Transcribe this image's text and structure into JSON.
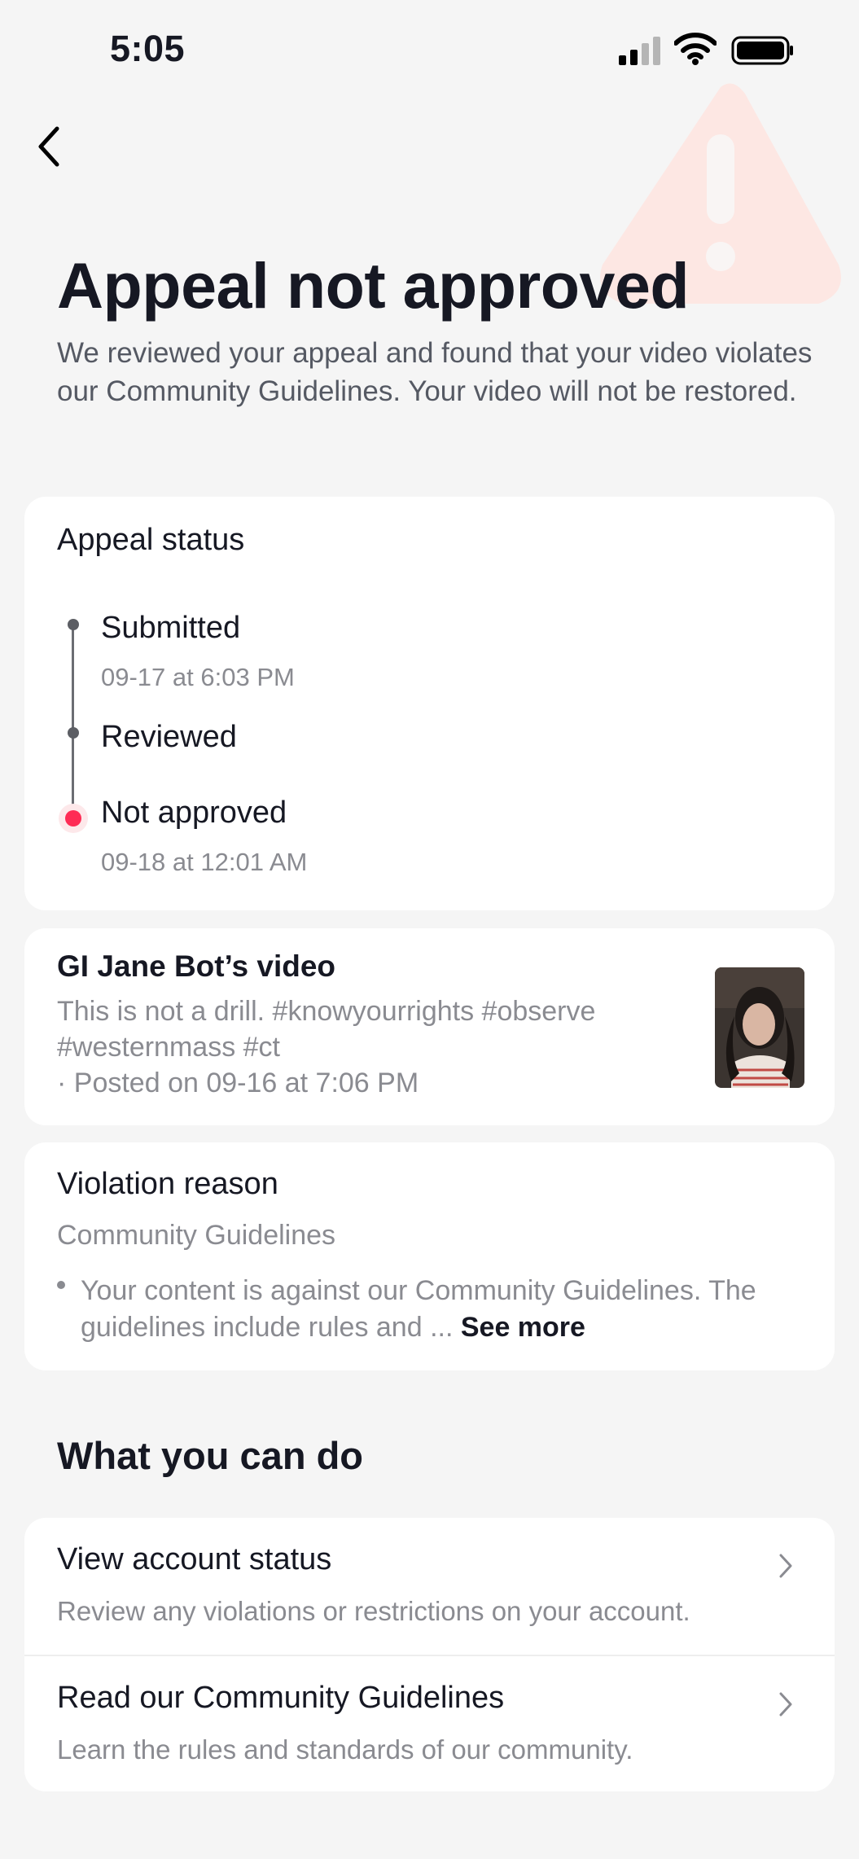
{
  "status_bar": {
    "time": "5:05"
  },
  "header": {
    "title": "Appeal not approved",
    "subtitle": "We reviewed your appeal and found that your video violates our Community Guidelines. Your video will not be restored."
  },
  "appeal_status": {
    "title": "Appeal status",
    "steps": [
      {
        "label": "Submitted",
        "time": "09-17 at 6:03 PM"
      },
      {
        "label": "Reviewed",
        "time": ""
      },
      {
        "label": "Not approved",
        "time": "09-18 at 12:01 AM"
      }
    ]
  },
  "video": {
    "title": "GI Jane Bot’s video",
    "description": "This is not a drill. #knowyourrights #observe #westernmass #ct",
    "posted": "· Posted on 09-16 at 7:06 PM"
  },
  "violation": {
    "title": "Violation reason",
    "category": "Community Guidelines",
    "detail": "Your content is against our Community Guidelines. The guidelines include rules and ... ",
    "see_more": "See more"
  },
  "what_you_can_do": {
    "title": "What you can do",
    "actions": [
      {
        "title": "View account status",
        "description": "Review any violations or restrictions on your account."
      },
      {
        "title": "Read our Community Guidelines",
        "description": "Learn the rules and standards of our community."
      }
    ]
  },
  "colors": {
    "background": "#f5f5f5",
    "card": "#ffffff",
    "accent_red": "#fe2c55",
    "muted_text": "#8a8b91"
  },
  "icons": [
    "back-chevron-icon",
    "warning-triangle-icon",
    "cellular-signal-icon",
    "wifi-icon",
    "battery-icon",
    "chevron-right-icon"
  ]
}
